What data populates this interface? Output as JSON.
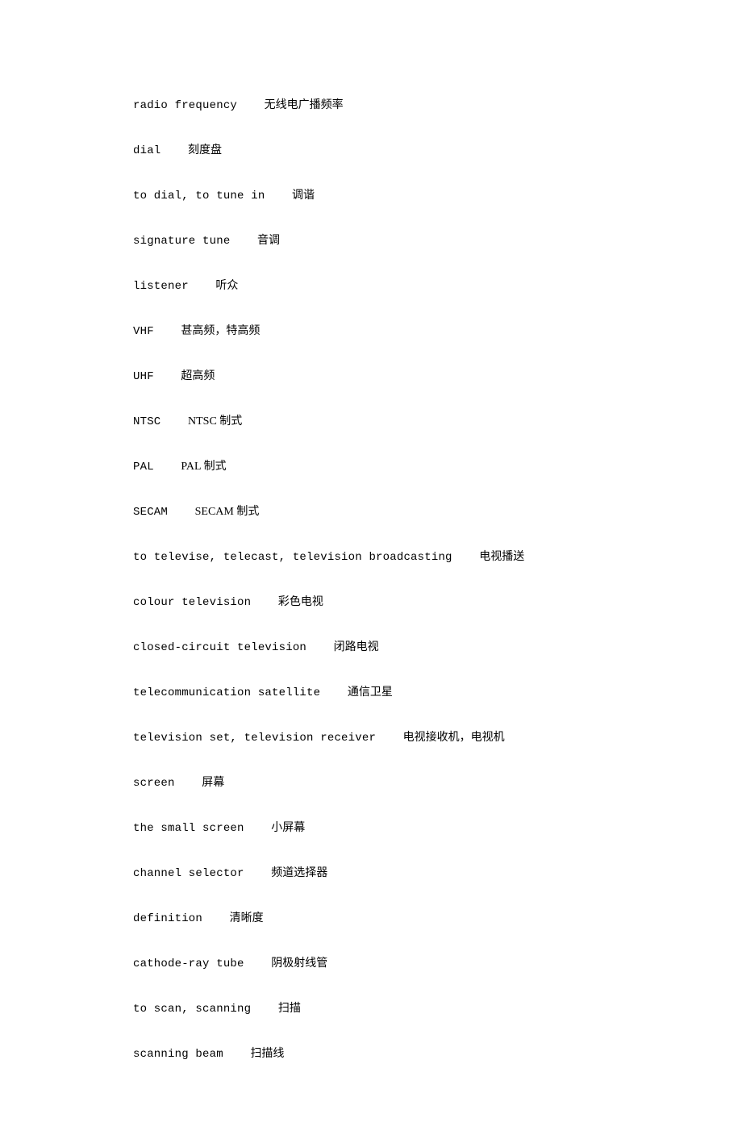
{
  "entries": [
    {
      "term": "radio frequency",
      "gap": "    ",
      "def": "无线电广播频率"
    },
    {
      "term": "dial",
      "gap": "    ",
      "def": "刻度盘"
    },
    {
      "term": "to dial, to tune in",
      "gap": "    ",
      "def": "调谐"
    },
    {
      "term": "signature tune",
      "gap": "    ",
      "def": "音调"
    },
    {
      "term": "listener",
      "gap": "    ",
      "def": "听众"
    },
    {
      "term": "VHF",
      "gap": "    ",
      "def": "甚高频，特高频"
    },
    {
      "term": "UHF",
      "gap": "    ",
      "def": "超高频"
    },
    {
      "term": "NTSC",
      "gap": "    ",
      "def": "NTSC 制式"
    },
    {
      "term": "PAL",
      "gap": "    ",
      "def": "PAL 制式"
    },
    {
      "term": "SECAM",
      "gap": "    ",
      "def": "SECAM 制式"
    },
    {
      "term": "to televise, telecast, television broadcasting",
      "gap": "    ",
      "def": "电视播送"
    },
    {
      "term": "colour television",
      "gap": "    ",
      "def": "彩色电视"
    },
    {
      "term": "closed-circuit television",
      "gap": "    ",
      "def": "闭路电视"
    },
    {
      "term": "telecommunication satellite",
      "gap": "    ",
      "def": "通信卫星"
    },
    {
      "term": "television set, television receiver",
      "gap": "    ",
      "def": "电视接收机，电视机"
    },
    {
      "term": "screen",
      "gap": "    ",
      "def": "屏幕"
    },
    {
      "term": "the small screen",
      "gap": "    ",
      "def": "小屏幕"
    },
    {
      "term": "channel selector",
      "gap": "    ",
      "def": "频道选择器"
    },
    {
      "term": "definition",
      "gap": "    ",
      "def": "清晰度"
    },
    {
      "term": "cathode-ray tube",
      "gap": "    ",
      "def": "阴极射线管"
    },
    {
      "term": "to scan, scanning",
      "gap": "    ",
      "def": "扫描"
    },
    {
      "term": "scanning beam",
      "gap": "    ",
      "def": "扫描线"
    }
  ]
}
